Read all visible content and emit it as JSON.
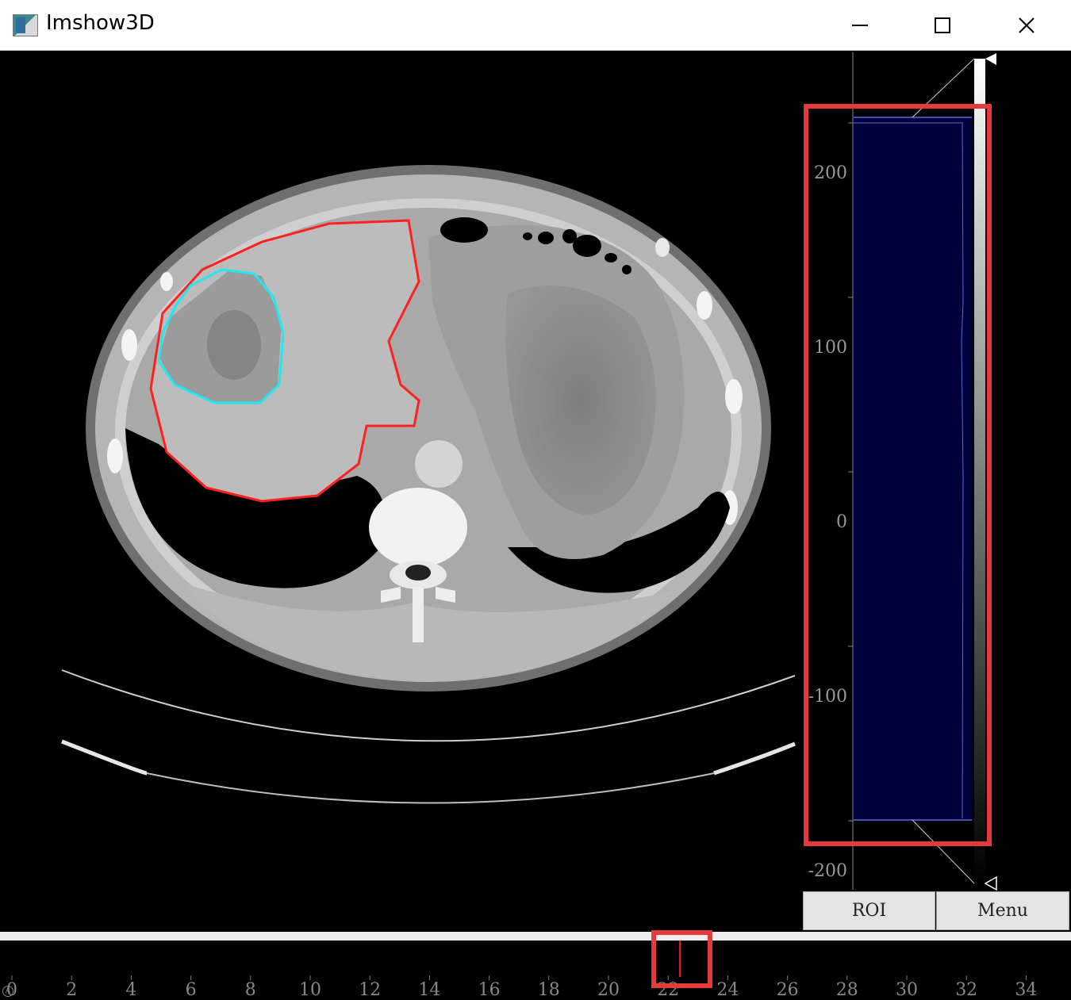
{
  "window": {
    "title": "Imshow3D",
    "icons": {
      "app": "image-app-icon",
      "minimize": "minimize-icon",
      "maximize": "maximize-icon",
      "close": "close-icon"
    }
  },
  "image": {
    "type": "axial CT slice",
    "contours": [
      {
        "name": "liver",
        "color": "#ff2020"
      },
      {
        "name": "tumor",
        "color": "#20e8f0"
      }
    ]
  },
  "histogram": {
    "axis_labels": [
      "200",
      "100",
      "0",
      "-100",
      "-200"
    ],
    "fill_color": "#00003c",
    "line_color": "#5a6ad8",
    "colorbar": "white-to-black gradient"
  },
  "buttons": {
    "roi": "ROI",
    "menu": "Menu"
  },
  "slice_slider": {
    "current": 22.4,
    "ticks": [
      "0",
      "2",
      "4",
      "6",
      "8",
      "10",
      "12",
      "14",
      "16",
      "18",
      "20",
      "22",
      "24",
      "26",
      "28",
      "30",
      "32",
      "34"
    ],
    "auto_badge": "A",
    "marker_color": "#ff2020"
  },
  "annotations": {
    "color": "#e53a3a"
  }
}
